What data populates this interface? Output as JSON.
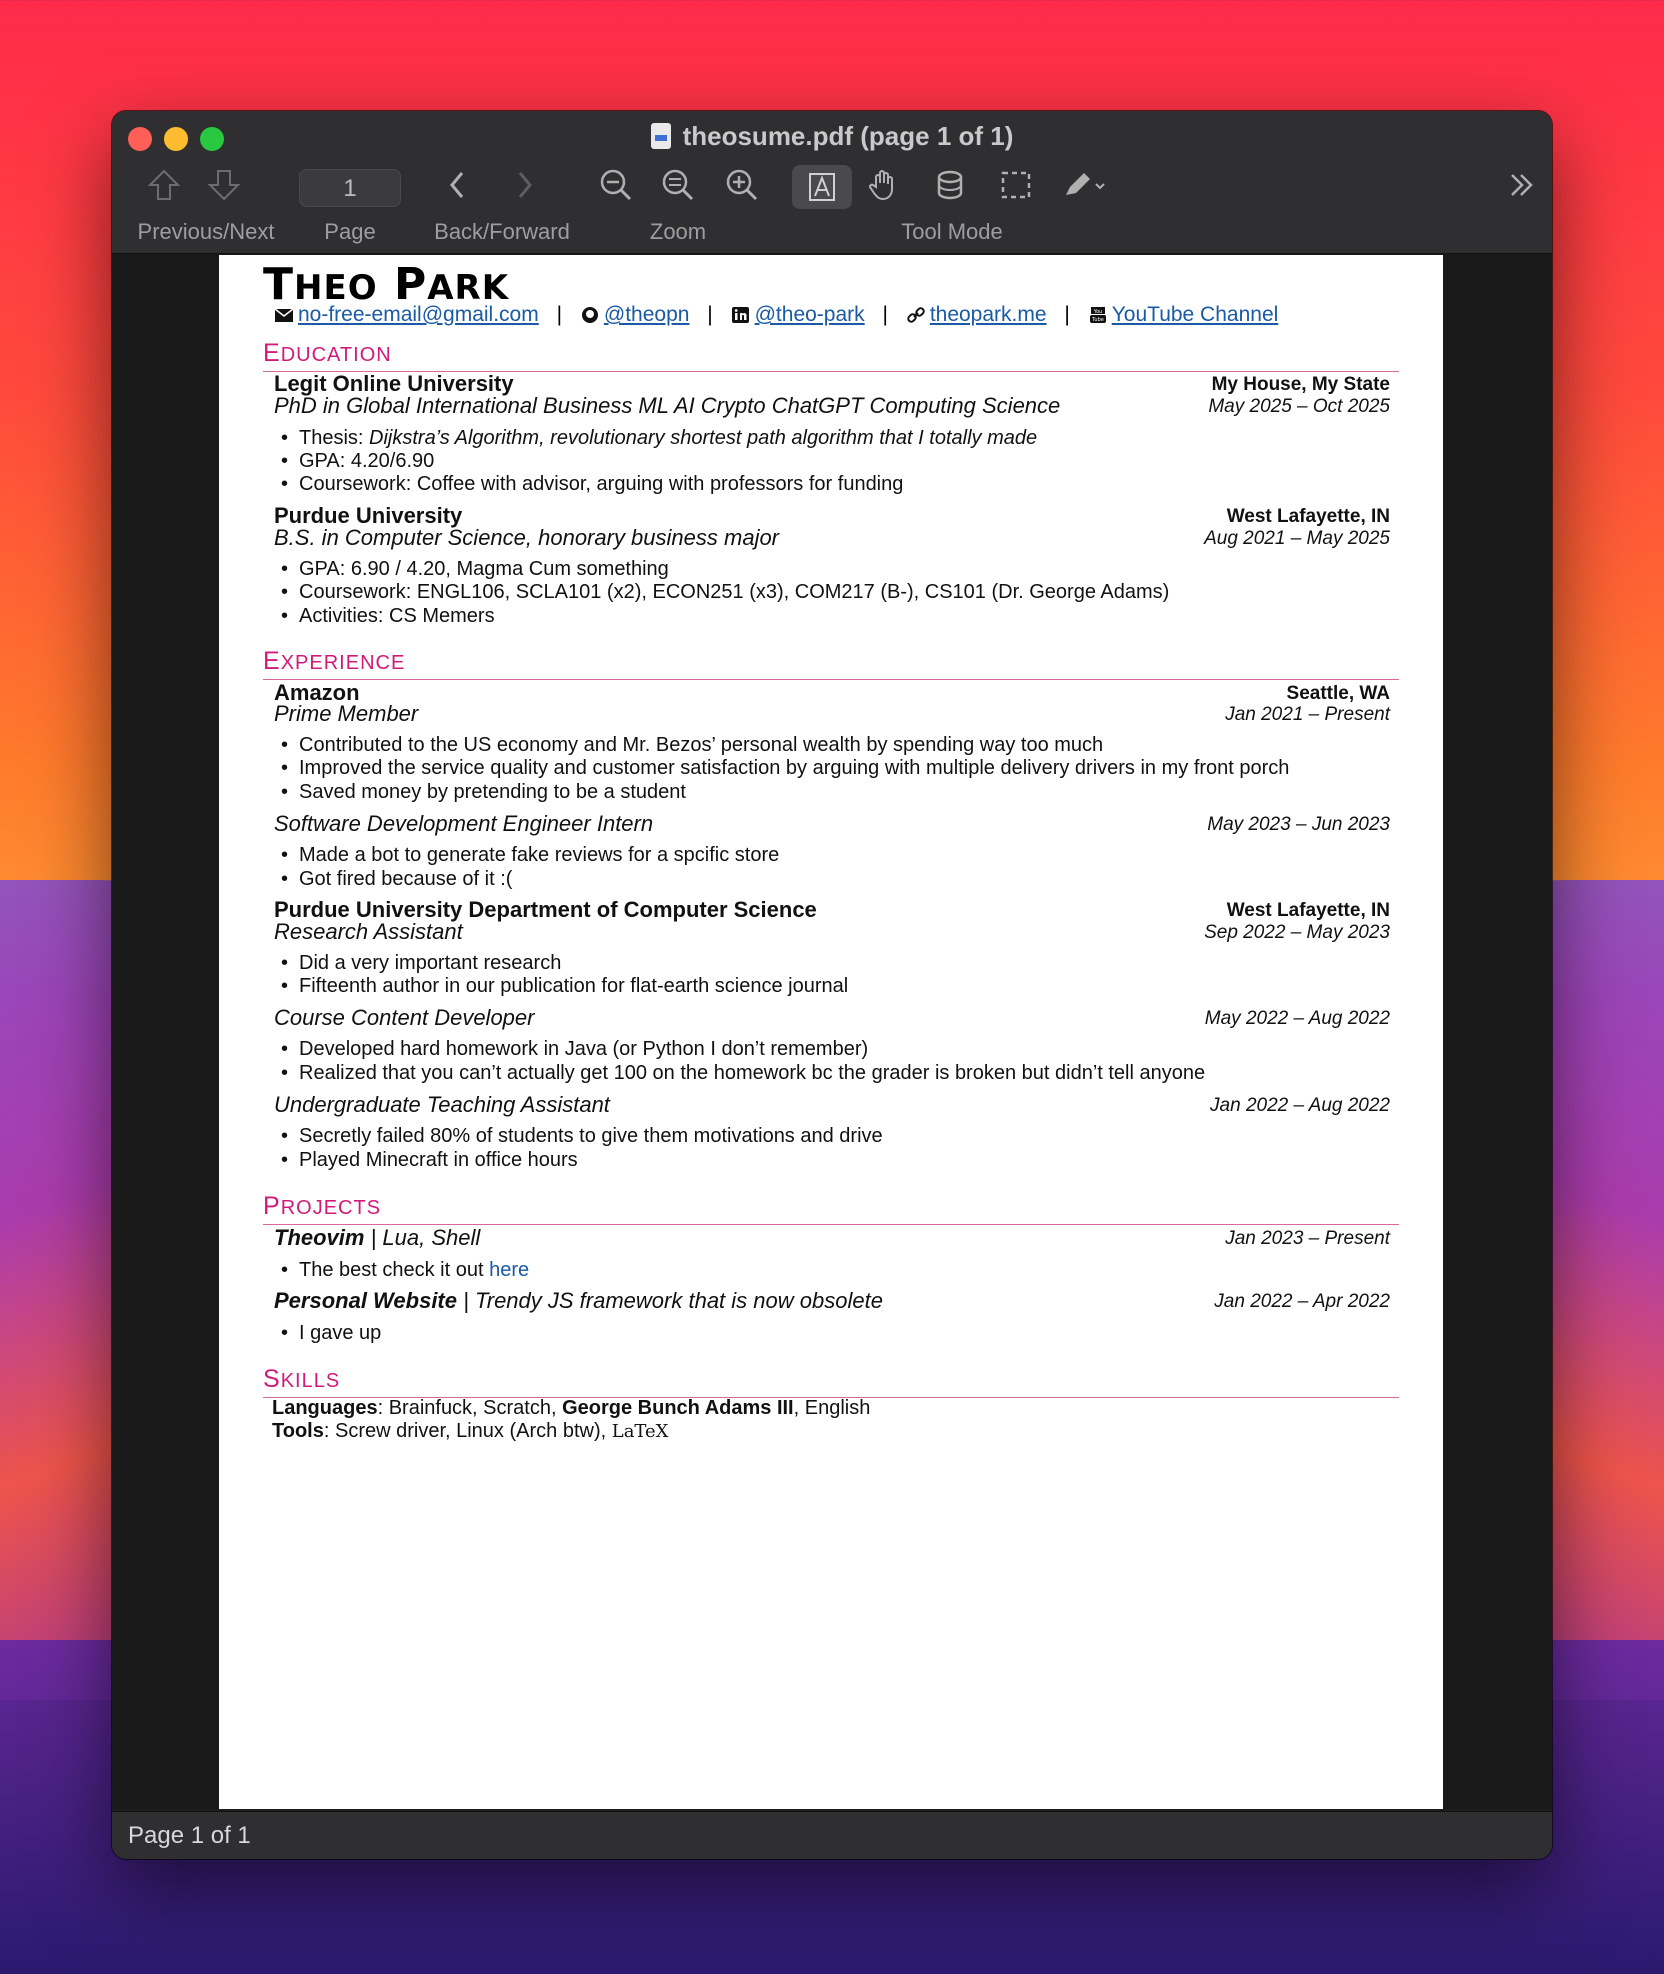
{
  "window": {
    "title": "theosume.pdf (page 1 of 1)",
    "page_field": "1",
    "status": "Page 1 of 1",
    "toolbar_labels": {
      "prev_next": "Previous/Next",
      "page": "Page",
      "back_forward": "Back/Forward",
      "zoom": "Zoom",
      "tool_mode": "Tool Mode"
    }
  },
  "resume": {
    "name": "Theo Park",
    "contacts": {
      "email": "no-free-email@gmail.com",
      "github": "@theopn",
      "linkedin": "@theo-park",
      "website": "theopark.me",
      "youtube": "YouTube Channel",
      "sep": "|"
    },
    "sections": {
      "education": "Education",
      "experience": "Experience",
      "projects": "Projects",
      "skills": "Skills"
    },
    "education": [
      {
        "school": "Legit Online University",
        "location": "My House, My State",
        "degree": "PhD in Global International Business ML AI Crypto ChatGPT Computing Science",
        "dates": "May 2025 – Oct 2025",
        "thesis_label": "Thesis: ",
        "thesis": "Dijkstra’s Algorithm, revolutionary shortest path algorithm that I totally made",
        "gpa": "GPA: 4.20/6.90",
        "coursework": "Coursework: Coffee with advisor, arguing with professors for funding"
      },
      {
        "school": "Purdue University",
        "location": "West Lafayette, IN",
        "degree": "B.S. in Computer Science, honorary business major",
        "dates": "Aug 2021 – May 2025",
        "bullets": [
          "GPA: 6.90 / 4.20, Magma Cum something",
          "Coursework: ENGL106, SCLA101 (x2), ECON251 (x3), COM217 (B-), CS101 (Dr. George Adams)",
          "Activities: CS Memers"
        ]
      }
    ],
    "experience": {
      "amazon": {
        "company": "Amazon",
        "location": "Seattle, WA",
        "role": "Prime Member",
        "dates": "Jan 2021 – Present",
        "bullets": [
          "Contributed to the US economy and Mr. Bezos’ personal wealth by spending way too much",
          "Improved the service quality and customer satisfaction by arguing with multiple delivery drivers in my front porch",
          "Saved money by pretending to be a student"
        ]
      },
      "amazon_intern": {
        "role": "Software Development Engineer Intern",
        "dates": "May 2023 – Jun 2023",
        "bullets": [
          "Made a bot to generate fake reviews for a spcific store",
          "Got fired because of it :("
        ]
      },
      "purdue_cs": {
        "company": "Purdue University Department of Computer Science",
        "location": "West Lafayette, IN",
        "role": "Research Assistant",
        "dates": "Sep 2022 – May 2023",
        "bullets": [
          "Did a very important research",
          "Fifteenth author in our publication for flat-earth science journal"
        ]
      },
      "content_dev": {
        "role": "Course Content Developer",
        "dates": "May 2022 – Aug 2022",
        "bullets": [
          "Developed hard homework in Java (or Python I don’t remember)",
          "Realized that you can’t actually get 100 on the homework bc the grader is broken but didn’t tell anyone"
        ]
      },
      "uta": {
        "role": "Undergraduate Teaching Assistant",
        "dates": "Jan 2022 – Aug 2022",
        "bullets": [
          "Secretly failed 80% of students to give them motivations and drive",
          "Played Minecraft in office hours"
        ]
      }
    },
    "projects": [
      {
        "name": "Theovim",
        "tech": " | Lua, Shell",
        "dates": "Jan 2023 – Present",
        "bullet_text": "The best check it out ",
        "bullet_link": "here"
      },
      {
        "name": "Personal Website",
        "tech": " | Trendy JS framework that is now obsolete",
        "dates": "Jan 2022 – Apr 2022",
        "bullet_text": "I gave up"
      }
    ],
    "skills": {
      "languages_label": "Languages",
      "languages_a": ": Brainfuck, Scratch, ",
      "languages_bold": "George Bunch Adams III",
      "languages_b": ", English",
      "tools_label": "Tools",
      "tools": ": Screw driver, Linux (Arch btw), ",
      "latex": "LaTeX"
    }
  },
  "colors": {
    "accent": "#d11b7a",
    "link": "#1a5aa6"
  }
}
